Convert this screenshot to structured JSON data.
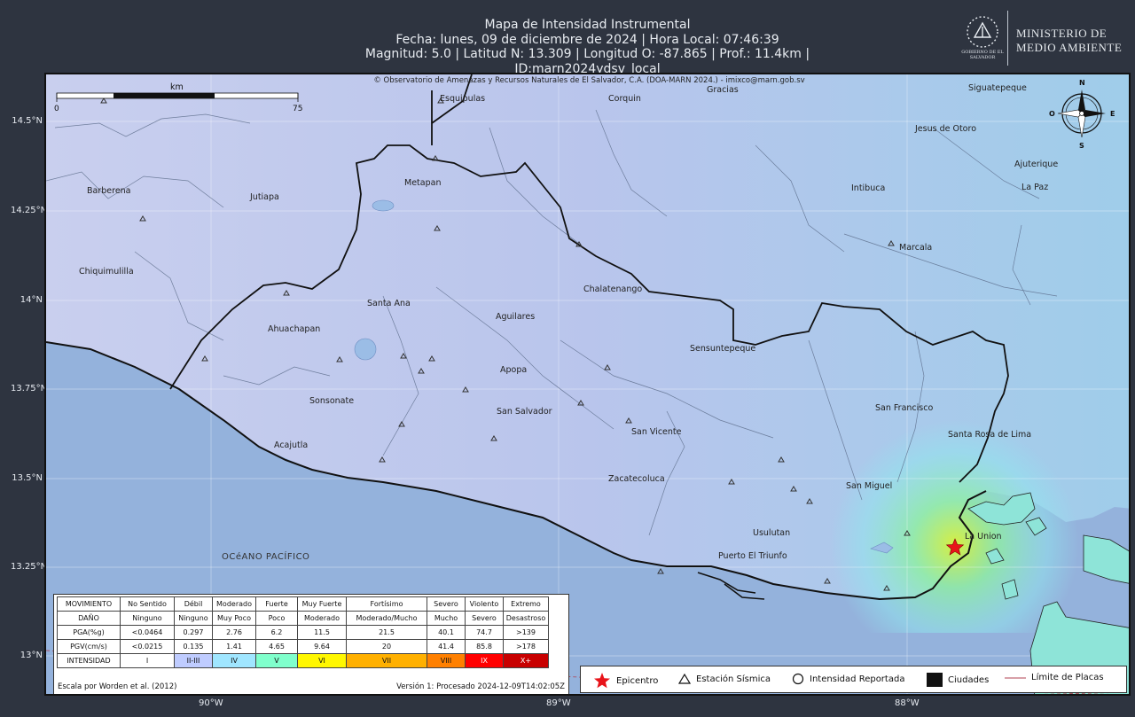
{
  "header": {
    "title": "Mapa de Intensidad Instrumental",
    "date_line": "Fecha: lunes, 09 de diciembre de 2024 | Hora Local: 07:46:39",
    "params_line": "Magnitud: 5.0 | Latitud N: 13.309 | Longitud O: -87.865 | Prof.: 11.4km | ID:marn2024ydsv_local",
    "logo_caption": "GOBIERNO DE EL SALVADOR",
    "ministry_line1": "MINISTERIO DE",
    "ministry_line2": "MEDIO AMBIENTE"
  },
  "map": {
    "copyright": "© Observatorio de Amenazas y Recursos Naturales de El Salvador, C.A. (DOA-MARN 2024.) - imixco@marn.gob.sv",
    "scale_unit": "km",
    "scale_start": "0",
    "scale_end": "75",
    "compass": {
      "n": "N",
      "s": "S",
      "e": "E",
      "o": "O"
    },
    "ocean_label": "OCéANO PACÍFICO",
    "lat_labels": [
      "14.5°N",
      "14.25°N",
      "14°N",
      "13.75°N",
      "13.5°N",
      "13.25°N",
      "13°N"
    ],
    "lon_labels": [
      "90°W",
      "89°W",
      "88°W"
    ],
    "places": [
      "Esquipulas",
      "Corquin",
      "Gracias",
      "Siguatepeque",
      "Jesus de Otoro",
      "Ajuterique",
      "La Paz",
      "Intibuca",
      "Barberena",
      "Jutiapa",
      "Metapan",
      "Chiquimulilla",
      "Marcala",
      "Chalatenango",
      "Santa Ana",
      "Ahuachapan",
      "Aguilares",
      "Sensuntepeque",
      "Apopa",
      "Sonsonate",
      "San Salvador",
      "San Francisco",
      "San Vicente",
      "Santa Rosa de Lima",
      "Acajutla",
      "Zacatecoluca",
      "San Miguel",
      "Usulutan",
      "La Union",
      "Puerto El Triunfo"
    ]
  },
  "intensity_table": {
    "headers": [
      "MOVIMIENTO",
      "No Sentido",
      "Débil",
      "Moderado",
      "Fuerte",
      "Muy Fuerte",
      "Fortísimo",
      "Severo",
      "Violento",
      "Extremo"
    ],
    "dano": [
      "DAÑO",
      "Ninguno",
      "Ninguno",
      "Muy Poco",
      "Poco",
      "Moderado",
      "Moderado/Mucho",
      "Mucho",
      "Severo",
      "Desastroso"
    ],
    "pga": [
      "PGA(%g)",
      "<0.0464",
      "0.297",
      "2.76",
      "6.2",
      "11.5",
      "21.5",
      "40.1",
      "74.7",
      ">139"
    ],
    "pgv": [
      "PGV(cm/s)",
      "<0.0215",
      "0.135",
      "1.41",
      "4.65",
      "9.64",
      "20",
      "41.4",
      "85.8",
      ">178"
    ],
    "intensidad": [
      "INTENSIDAD",
      "I",
      "II-III",
      "IV",
      "V",
      "VI",
      "VII",
      "VIII",
      "IX",
      "X+"
    ],
    "colors": [
      "#ffffff",
      "#ffffff",
      "#bfccff",
      "#a0e6ff",
      "#80ffcc",
      "#fff700",
      "#ffb000",
      "#ff8000",
      "#ff0000",
      "#c80000"
    ],
    "footer_left": "Escala por Worden et al. (2012)",
    "footer_right": "Versión 1: Procesado 2024-12-09T14:02:05Z"
  },
  "symbol_legend": {
    "epicenter": "Epicentro",
    "station": "Estación Sísmica",
    "reported": "Intensidad Reportada",
    "cities": "Ciudades",
    "plates": "Límite de Placas"
  }
}
